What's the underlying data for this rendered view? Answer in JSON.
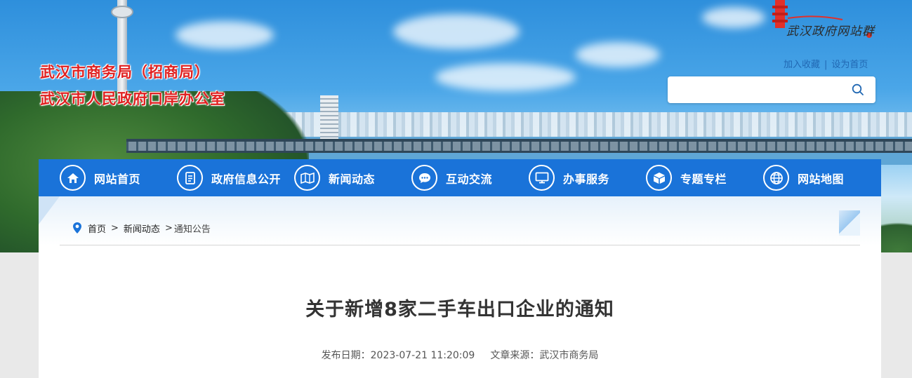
{
  "header": {
    "title_line1": "武汉市商务局（招商局）",
    "title_line2": "武汉市人民政府口岸办公室",
    "brand_logo_text": "武汉政府网站群",
    "links": {
      "favorite": "加入收藏",
      "separator": "|",
      "homepage": "设为首页"
    },
    "search": {
      "placeholder": ""
    }
  },
  "nav": {
    "items": [
      {
        "label": "网站首页",
        "icon": "home-icon"
      },
      {
        "label": "政府信息公开",
        "icon": "document-icon"
      },
      {
        "label": "新闻动态",
        "icon": "map-news-icon"
      },
      {
        "label": "互动交流",
        "icon": "chat-icon"
      },
      {
        "label": "办事服务",
        "icon": "monitor-icon"
      },
      {
        "label": "专题专栏",
        "icon": "cube-icon"
      },
      {
        "label": "网站地图",
        "icon": "globe-icon"
      }
    ]
  },
  "breadcrumb": {
    "home": "首页",
    "sep1": ">",
    "section": "新闻动态",
    "sep2": ">",
    "current": "通知公告"
  },
  "article": {
    "title": "关于新增8家二手车出口企业的通知",
    "date_label": "发布日期：",
    "date": "2023-07-21 11:20:09",
    "source_label": "文章来源：",
    "source": "武汉市商务局"
  },
  "colors": {
    "nav_bg": "#1a73d9",
    "title_red": "#e02121",
    "link_blue": "#2168b3"
  }
}
